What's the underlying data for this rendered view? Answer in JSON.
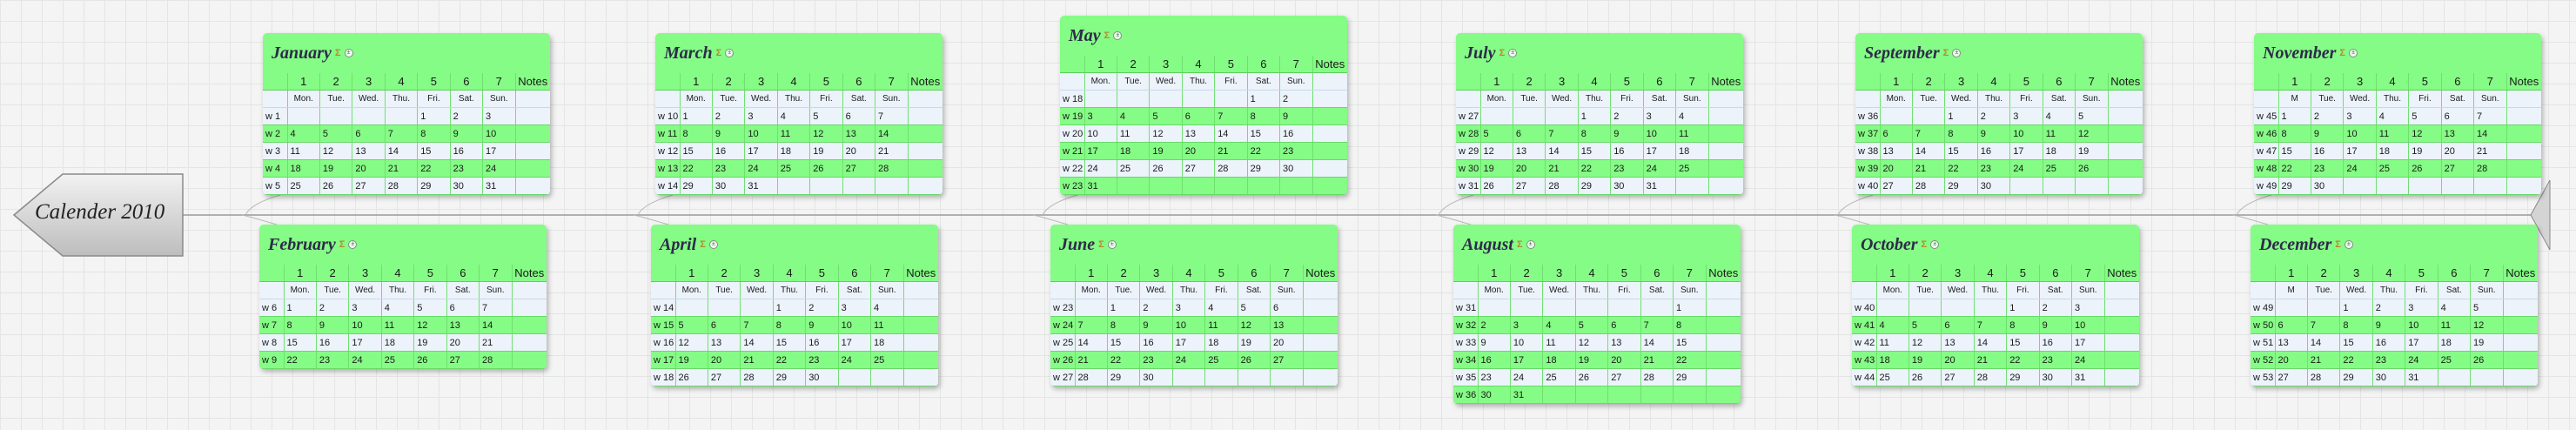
{
  "title": "Calender 2010",
  "sum_symbol": "Σ",
  "toggle_symbol": "±",
  "week_header": [
    "1",
    "2",
    "3",
    "4",
    "5",
    "6",
    "7",
    "Notes"
  ],
  "day_header": [
    "Mon.",
    "Tue.",
    "Wed.",
    "Thu.",
    "Fri.",
    "Sat.",
    "Sun."
  ],
  "colors": {
    "card": "#85fc85",
    "alt_row": "#ecf3fb",
    "spine": "#9a9a9a"
  },
  "months": [
    {
      "name": "January",
      "weeks": [
        [
          "w 1",
          "",
          "",
          "",
          "",
          "1",
          "2",
          "3"
        ],
        [
          "w 2",
          "4",
          "5",
          "6",
          "7",
          "8",
          "9",
          "10"
        ],
        [
          "w 3",
          "11",
          "12",
          "13",
          "14",
          "15",
          "16",
          "17"
        ],
        [
          "w 4",
          "18",
          "19",
          "20",
          "21",
          "22",
          "23",
          "24"
        ],
        [
          "w 5",
          "25",
          "26",
          "27",
          "28",
          "29",
          "30",
          "31"
        ]
      ]
    },
    {
      "name": "February",
      "weeks": [
        [
          "w 6",
          "1",
          "2",
          "3",
          "4",
          "5",
          "6",
          "7"
        ],
        [
          "w 7",
          "8",
          "9",
          "10",
          "11",
          "12",
          "13",
          "14"
        ],
        [
          "w 8",
          "15",
          "16",
          "17",
          "18",
          "19",
          "20",
          "21"
        ],
        [
          "w 9",
          "22",
          "23",
          "24",
          "25",
          "26",
          "27",
          "28"
        ]
      ]
    },
    {
      "name": "March",
      "weeks": [
        [
          "w 10",
          "1",
          "2",
          "3",
          "4",
          "5",
          "6",
          "7"
        ],
        [
          "w 11",
          "8",
          "9",
          "10",
          "11",
          "12",
          "13",
          "14"
        ],
        [
          "w 12",
          "15",
          "16",
          "17",
          "18",
          "19",
          "20",
          "21"
        ],
        [
          "w 13",
          "22",
          "23",
          "24",
          "25",
          "26",
          "27",
          "28"
        ],
        [
          "w 14",
          "29",
          "30",
          "31",
          "",
          "",
          "",
          ""
        ]
      ]
    },
    {
      "name": "April",
      "weeks": [
        [
          "w 14",
          "",
          "",
          "",
          "1",
          "2",
          "3",
          "4"
        ],
        [
          "w 15",
          "5",
          "6",
          "7",
          "8",
          "9",
          "10",
          "11"
        ],
        [
          "w 16",
          "12",
          "13",
          "14",
          "15",
          "16",
          "17",
          "18"
        ],
        [
          "w 17",
          "19",
          "20",
          "21",
          "22",
          "23",
          "24",
          "25"
        ],
        [
          "w 18",
          "26",
          "27",
          "28",
          "29",
          "30",
          "",
          ""
        ]
      ]
    },
    {
      "name": "May",
      "weeks": [
        [
          "w 18",
          "",
          "",
          "",
          "",
          "",
          "1",
          "2"
        ],
        [
          "w 19",
          "3",
          "4",
          "5",
          "6",
          "7",
          "8",
          "9"
        ],
        [
          "w 20",
          "10",
          "11",
          "12",
          "13",
          "14",
          "15",
          "16"
        ],
        [
          "w 21",
          "17",
          "18",
          "19",
          "20",
          "21",
          "22",
          "23"
        ],
        [
          "w 22",
          "24",
          "25",
          "26",
          "27",
          "28",
          "29",
          "30"
        ],
        [
          "w 23",
          "31",
          "",
          "",
          "",
          "",
          "",
          ""
        ]
      ]
    },
    {
      "name": "June",
      "weeks": [
        [
          "w 23",
          "",
          "1",
          "2",
          "3",
          "4",
          "5",
          "6"
        ],
        [
          "w 24",
          "7",
          "8",
          "9",
          "10",
          "11",
          "12",
          "13"
        ],
        [
          "w 25",
          "14",
          "15",
          "16",
          "17",
          "18",
          "19",
          "20"
        ],
        [
          "w 26",
          "21",
          "22",
          "23",
          "24",
          "25",
          "26",
          "27"
        ],
        [
          "w 27",
          "28",
          "29",
          "30",
          "",
          "",
          "",
          ""
        ]
      ]
    },
    {
      "name": "July",
      "weeks": [
        [
          "w 27",
          "",
          "",
          "",
          "1",
          "2",
          "3",
          "4"
        ],
        [
          "w 28",
          "5",
          "6",
          "7",
          "8",
          "9",
          "10",
          "11"
        ],
        [
          "w 29",
          "12",
          "13",
          "14",
          "15",
          "16",
          "17",
          "18"
        ],
        [
          "w 30",
          "19",
          "20",
          "21",
          "22",
          "23",
          "24",
          "25"
        ],
        [
          "w 31",
          "26",
          "27",
          "28",
          "29",
          "30",
          "31",
          ""
        ]
      ]
    },
    {
      "name": "August",
      "weeks": [
        [
          "w 31",
          "",
          "",
          "",
          "",
          "",
          "",
          "1"
        ],
        [
          "w 32",
          "2",
          "3",
          "4",
          "5",
          "6",
          "7",
          "8"
        ],
        [
          "w 33",
          "9",
          "10",
          "11",
          "12",
          "13",
          "14",
          "15"
        ],
        [
          "w 34",
          "16",
          "17",
          "18",
          "19",
          "20",
          "21",
          "22"
        ],
        [
          "w 35",
          "23",
          "24",
          "25",
          "26",
          "27",
          "28",
          "29"
        ],
        [
          "w 36",
          "30",
          "31",
          "",
          "",
          "",
          "",
          ""
        ]
      ]
    },
    {
      "name": "September",
      "weeks": [
        [
          "w 36",
          "",
          "",
          "1",
          "2",
          "3",
          "4",
          "5"
        ],
        [
          "w 37",
          "6",
          "7",
          "8",
          "9",
          "10",
          "11",
          "12"
        ],
        [
          "w 38",
          "13",
          "14",
          "15",
          "16",
          "17",
          "18",
          "19"
        ],
        [
          "w 39",
          "20",
          "21",
          "22",
          "23",
          "24",
          "25",
          "26"
        ],
        [
          "w 40",
          "27",
          "28",
          "29",
          "30",
          "",
          "",
          ""
        ]
      ]
    },
    {
      "name": "October",
      "weeks": [
        [
          "w 40",
          "",
          "",
          "",
          "",
          "1",
          "2",
          "3"
        ],
        [
          "w 41",
          "4",
          "5",
          "6",
          "7",
          "8",
          "9",
          "10"
        ],
        [
          "w 42",
          "11",
          "12",
          "13",
          "14",
          "15",
          "16",
          "17"
        ],
        [
          "w 43",
          "18",
          "19",
          "20",
          "21",
          "22",
          "23",
          "24"
        ],
        [
          "w 44",
          "25",
          "26",
          "27",
          "28",
          "29",
          "30",
          "31"
        ]
      ]
    },
    {
      "name": "November",
      "day_header": [
        "M",
        "Tue.",
        "Wed.",
        "Thu.",
        "Fri.",
        "Sat.",
        "Sun."
      ],
      "weeks": [
        [
          "w 45",
          "1",
          "2",
          "3",
          "4",
          "5",
          "6",
          "7"
        ],
        [
          "w 46",
          "8",
          "9",
          "10",
          "11",
          "12",
          "13",
          "14"
        ],
        [
          "w 47",
          "15",
          "16",
          "17",
          "18",
          "19",
          "20",
          "21"
        ],
        [
          "w 48",
          "22",
          "23",
          "24",
          "25",
          "26",
          "27",
          "28"
        ],
        [
          "w 49",
          "29",
          "30",
          "",
          "",
          "",
          "",
          ""
        ]
      ]
    },
    {
      "name": "December",
      "day_header": [
        "M",
        "Tue.",
        "Wed.",
        "Thu.",
        "Fri.",
        "Sat.",
        "Sun."
      ],
      "weeks": [
        [
          "w 49",
          "",
          "",
          "1",
          "2",
          "3",
          "4",
          "5"
        ],
        [
          "w 50",
          "6",
          "7",
          "8",
          "9",
          "10",
          "11",
          "12"
        ],
        [
          "w 51",
          "13",
          "14",
          "15",
          "16",
          "17",
          "18",
          "19"
        ],
        [
          "w 52",
          "20",
          "21",
          "22",
          "23",
          "24",
          "25",
          "26"
        ],
        [
          "w 53",
          "27",
          "28",
          "29",
          "30",
          "31",
          "",
          ""
        ]
      ]
    }
  ]
}
